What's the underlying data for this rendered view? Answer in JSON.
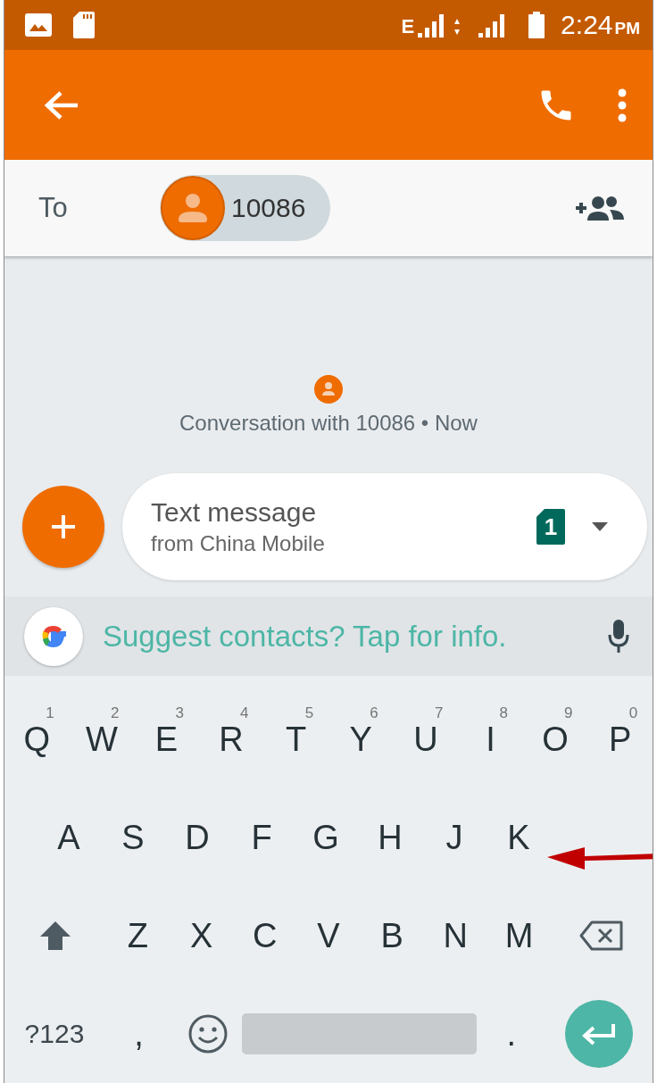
{
  "status_bar": {
    "network_type": "E",
    "time": "2:24",
    "meridiem": "PM"
  },
  "recipients": {
    "label": "To",
    "chips": [
      {
        "name": "10086"
      }
    ]
  },
  "conversation": {
    "summary": "Conversation with 10086 • Now"
  },
  "compose": {
    "placeholder": "Text message",
    "subtitle": "from China Mobile",
    "sim": "1"
  },
  "suggestion": {
    "text": "Suggest contacts? Tap for info."
  },
  "keyboard": {
    "rows": [
      [
        {
          "kind": "letter",
          "label": "Q",
          "hint": "1"
        },
        {
          "kind": "letter",
          "label": "W",
          "hint": "2"
        },
        {
          "kind": "letter",
          "label": "E",
          "hint": "3"
        },
        {
          "kind": "letter",
          "label": "R",
          "hint": "4"
        },
        {
          "kind": "letter",
          "label": "T",
          "hint": "5"
        },
        {
          "kind": "letter",
          "label": "Y",
          "hint": "6"
        },
        {
          "kind": "letter",
          "label": "U",
          "hint": "7"
        },
        {
          "kind": "letter",
          "label": "I",
          "hint": "8"
        },
        {
          "kind": "letter",
          "label": "O",
          "hint": "9"
        },
        {
          "kind": "letter",
          "label": "P",
          "hint": "0"
        }
      ],
      [
        {
          "kind": "letter",
          "label": "A"
        },
        {
          "kind": "letter",
          "label": "S"
        },
        {
          "kind": "letter",
          "label": "D"
        },
        {
          "kind": "letter",
          "label": "F"
        },
        {
          "kind": "letter",
          "label": "G"
        },
        {
          "kind": "letter",
          "label": "H"
        },
        {
          "kind": "letter",
          "label": "J"
        },
        {
          "kind": "letter",
          "label": "K"
        }
      ],
      [
        {
          "kind": "shift"
        },
        {
          "kind": "letter",
          "label": "Z"
        },
        {
          "kind": "letter",
          "label": "X"
        },
        {
          "kind": "letter",
          "label": "C"
        },
        {
          "kind": "letter",
          "label": "V"
        },
        {
          "kind": "letter",
          "label": "B"
        },
        {
          "kind": "letter",
          "label": "N"
        },
        {
          "kind": "letter",
          "label": "M"
        },
        {
          "kind": "backspace"
        }
      ]
    ],
    "bottom_bar": {
      "symbols_key": "?123",
      "comma_key": ",",
      "period_key": "."
    }
  }
}
